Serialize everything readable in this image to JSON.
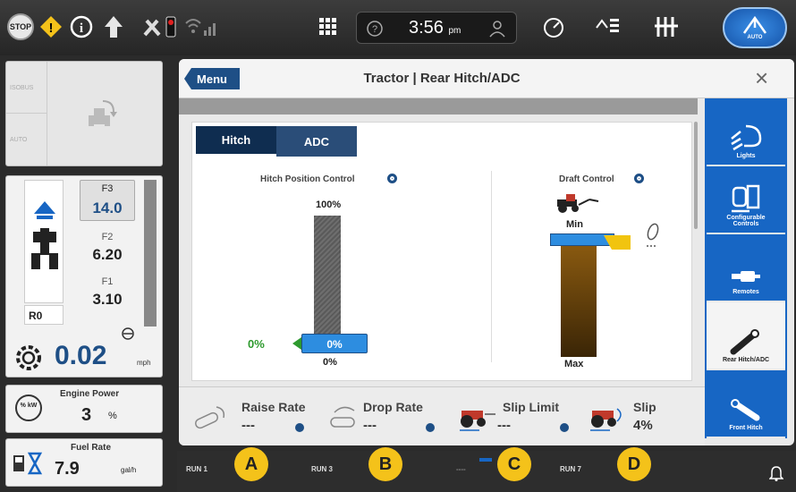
{
  "topbar": {
    "time": "3:56",
    "ampm": "pm",
    "auto_label": "AUTO"
  },
  "left_panel": {
    "isobus_label": "ISOBUS",
    "auto_label": "AUTO",
    "gear_label": "R0",
    "gears": [
      {
        "name": "F3",
        "value": "14.0"
      },
      {
        "name": "F2",
        "value": "6.20"
      },
      {
        "name": "F1",
        "value": "3.10"
      }
    ],
    "speed": "0.02",
    "speed_unit": "mph",
    "engine_power_label": "Engine Power",
    "engine_power_value": "3",
    "engine_power_unit": "%",
    "engine_icon_text": "% kW",
    "fuel_rate_label": "Fuel Rate",
    "fuel_rate_value": "7.9",
    "fuel_rate_unit": "gal/h"
  },
  "main": {
    "menu_label": "Menu",
    "title": "Tractor | Rear Hitch/ADC",
    "tabs": [
      {
        "label": "Hitch"
      },
      {
        "label": "ADC"
      }
    ],
    "hitch": {
      "title": "Hitch Position Control",
      "max": "100%",
      "setpoint": "0%",
      "actual": "0%",
      "bottom": "0%",
      "position_fraction": 0
    },
    "draft": {
      "title": "Draft Control",
      "min_label": "Min",
      "max_label": "Max"
    },
    "rates": [
      {
        "label": "Raise Rate",
        "value": "---"
      },
      {
        "label": "Drop Rate",
        "value": "---"
      },
      {
        "label": "Slip Limit",
        "value": "---"
      },
      {
        "label": "Slip",
        "value": "4%"
      }
    ]
  },
  "right_bar": [
    {
      "label": "Lights"
    },
    {
      "label": "Configurable Controls"
    },
    {
      "label": "Remotes"
    },
    {
      "label": "Rear Hitch/ADC"
    },
    {
      "label": "Front Hitch"
    }
  ],
  "bottom": {
    "runs": [
      "RUN 1",
      "RUN 3",
      "----",
      "RUN 7"
    ],
    "callouts": [
      "A",
      "B",
      "C",
      "D"
    ]
  },
  "colors": {
    "accent": "#1766c4",
    "navy": "#1e4f86",
    "green": "#2e9a2e",
    "callout": "#f4c21a"
  }
}
